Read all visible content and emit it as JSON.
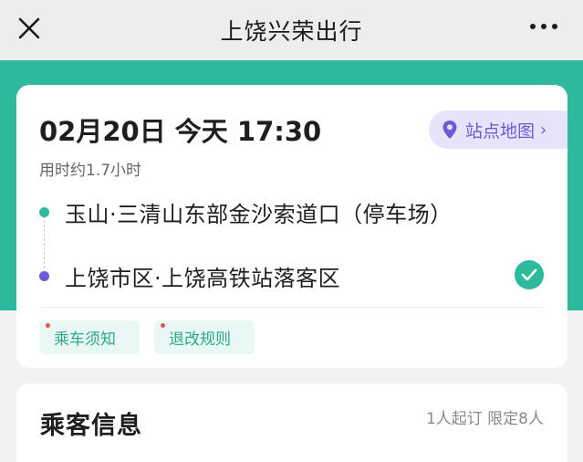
{
  "header": {
    "title": "上饶兴荣出行",
    "close_icon": "close-icon",
    "more_icon": "more-icon"
  },
  "trip": {
    "date_time": "02月20日 今天 17:30",
    "duration": "用时约1.7小时",
    "map_button": {
      "label": "站点地图",
      "icon": "location-pin-icon"
    },
    "origin": "玉山·三清山东部金沙索道口（停车场）",
    "destination": "上饶市区·上饶高铁站落客区",
    "tags": [
      {
        "label": "乘车须知"
      },
      {
        "label": "退改规则"
      }
    ]
  },
  "passenger": {
    "title": "乘客信息",
    "limit": "1人起订 限定8人"
  },
  "colors": {
    "accent_green": "#2db99b",
    "accent_purple": "#6d5bd6",
    "badge_red": "#e9534a"
  }
}
